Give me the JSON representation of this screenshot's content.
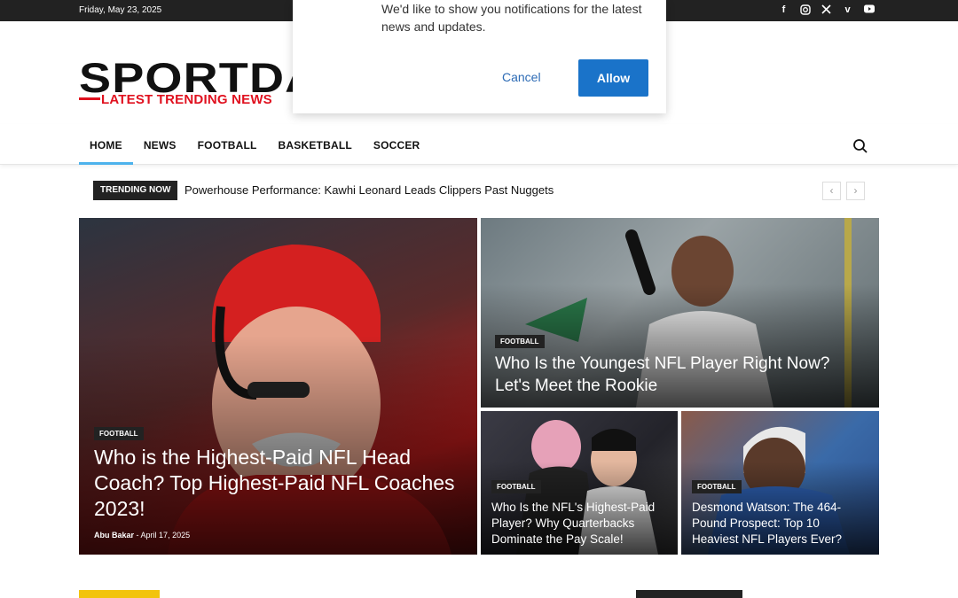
{
  "topbar": {
    "date": "Friday, May 23, 2025",
    "social": [
      "facebook-icon",
      "instagram-icon",
      "x-icon",
      "vimeo-icon",
      "youtube-icon"
    ]
  },
  "logo": {
    "name": "SPORTDA",
    "tagline": "LATEST TRENDING NEWS"
  },
  "nav": {
    "items": [
      {
        "label": "HOME",
        "active": true
      },
      {
        "label": "NEWS"
      },
      {
        "label": "FOOTBALL"
      },
      {
        "label": "BASKETBALL"
      },
      {
        "label": "SOCCER"
      }
    ]
  },
  "trending": {
    "label": "TRENDING NOW",
    "headline": "Powerhouse Performance: Kawhi Leonard Leads Clippers Past Nuggets",
    "prev": "‹",
    "next": "›"
  },
  "popup": {
    "message": "We'd like to show you notifications for the latest news and updates.",
    "cancel": "Cancel",
    "allow": "Allow"
  },
  "featured": [
    {
      "category": "FOOTBALL",
      "title": "Who is the Highest-Paid NFL Head Coach? Top Highest-Paid NFL Coaches 2023!",
      "author": "Abu Bakar",
      "separator": "-",
      "date": "April 17, 2025"
    },
    {
      "category": "FOOTBALL",
      "title": "Who Is the Youngest NFL Player Right Now? Let's Meet the Rookie"
    },
    {
      "category": "FOOTBALL",
      "title": "Who Is the NFL's Highest-Paid Player? Why Quarterbacks Dominate the Pay Scale!"
    },
    {
      "category": "FOOTBALL",
      "title": "Desmond Watson: The 464-Pound Prospect: Top 10 Heaviest NFL Players Ever?"
    }
  ],
  "colors": {
    "accent": "#4db2ec",
    "brand_red": "#e0111f",
    "allow_button": "#1a73c9",
    "dark": "#222222"
  }
}
